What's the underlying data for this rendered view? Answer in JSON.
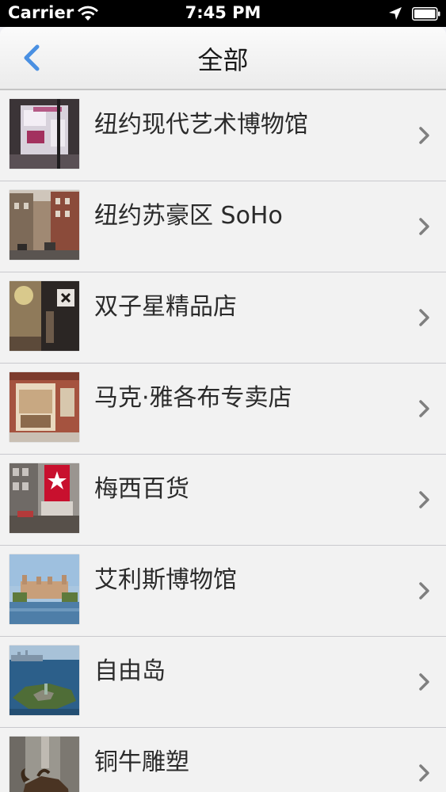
{
  "status_bar": {
    "carrier": "Carrier",
    "time": "7:45 PM"
  },
  "nav": {
    "title": "全部",
    "back_icon": "chevron-left-icon",
    "accent_color": "#4a90e2"
  },
  "list": {
    "items": [
      {
        "label": "纽约现代艺术博物馆",
        "thumb": "museum-of-modern-art-photo"
      },
      {
        "label": "纽约苏豪区 SoHo",
        "thumb": "soho-street-photo"
      },
      {
        "label": "双子星精品店",
        "thumb": "boutique-shop-photo"
      },
      {
        "label": "马克·雅各布专卖店",
        "thumb": "marc-jacobs-store-photo"
      },
      {
        "label": "梅西百货",
        "thumb": "macys-building-photo"
      },
      {
        "label": "艾利斯博物馆",
        "thumb": "ellis-island-museum-photo"
      },
      {
        "label": "自由岛",
        "thumb": "liberty-island-photo"
      },
      {
        "label": "铜牛雕塑",
        "thumb": "charging-bull-photo"
      }
    ]
  }
}
